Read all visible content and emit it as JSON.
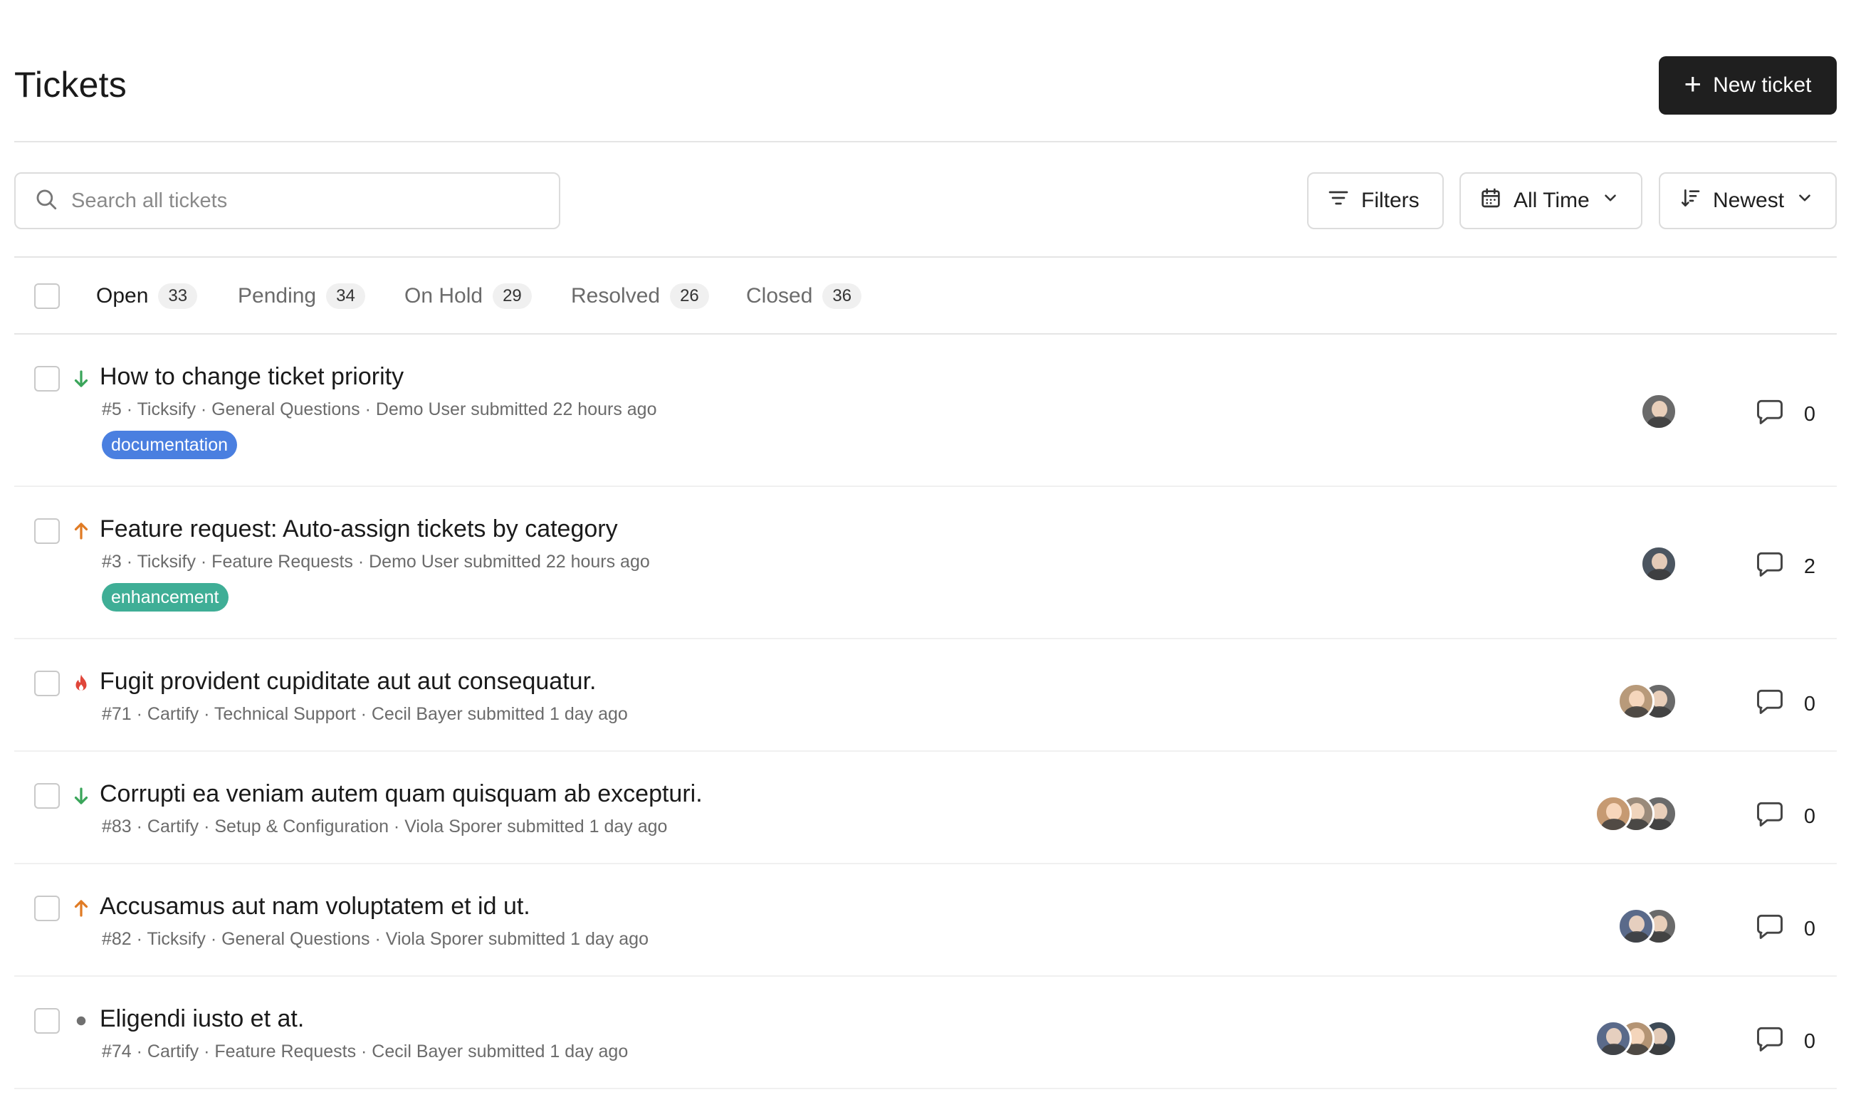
{
  "header": {
    "title": "Tickets",
    "new_button_label": "New ticket"
  },
  "toolbar": {
    "search_placeholder": "Search all tickets",
    "filters_label": "Filters",
    "time_label": "All Time",
    "sort_label": "Newest"
  },
  "tabs": [
    {
      "label": "Open",
      "count": "33"
    },
    {
      "label": "Pending",
      "count": "34"
    },
    {
      "label": "On Hold",
      "count": "29"
    },
    {
      "label": "Resolved",
      "count": "26"
    },
    {
      "label": "Closed",
      "count": "36"
    }
  ],
  "tickets": [
    {
      "title": "How to change ticket priority",
      "meta": "#5 · Ticksify · General Questions · Demo User submitted 22 hours ago",
      "priority": "low",
      "tag": "documentation",
      "tag_color": "#4a7fe0",
      "avatars": [
        "#6a6a6a"
      ],
      "comments": "0"
    },
    {
      "title": "Feature request: Auto-assign tickets by category",
      "meta": "#3 · Ticksify · Feature Requests · Demo User submitted 22 hours ago",
      "priority": "high",
      "tag": "enhancement",
      "tag_color": "#3fae96",
      "avatars": [
        "#4b5560"
      ],
      "comments": "2"
    },
    {
      "title": "Fugit provident cupiditate aut aut consequatur.",
      "meta": "#71 · Cartify · Technical Support · Cecil Bayer submitted 1 day ago",
      "priority": "urgent",
      "tag": "",
      "avatars": [
        "#6a6a6a",
        "#b89a7a"
      ],
      "comments": "0"
    },
    {
      "title": "Corrupti ea veniam autem quam quisquam ab excepturi.",
      "meta": "#83 · Cartify · Setup & Configuration · Viola Sporer submitted 1 day ago",
      "priority": "low",
      "tag": "",
      "avatars": [
        "#6a6a6a",
        "#9a8a7a",
        "#c69a72"
      ],
      "comments": "0"
    },
    {
      "title": "Accusamus aut nam voluptatem et id ut.",
      "meta": "#82 · Ticksify · General Questions · Viola Sporer submitted 1 day ago",
      "priority": "high",
      "tag": "",
      "avatars": [
        "#6a6a6a",
        "#5a6a8a"
      ],
      "comments": "0"
    },
    {
      "title": "Eligendi iusto et at.",
      "meta": "#74 · Cartify · Feature Requests · Cecil Bayer submitted 1 day ago",
      "priority": "normal",
      "tag": "",
      "avatars": [
        "#3e4a56",
        "#b49474",
        "#5a6a8a"
      ],
      "comments": "0"
    }
  ],
  "colors": {
    "low": "#3aa55a",
    "high": "#e07b24",
    "urgent": "#e0463a",
    "normal": "#707070",
    "icon": "#444444"
  }
}
